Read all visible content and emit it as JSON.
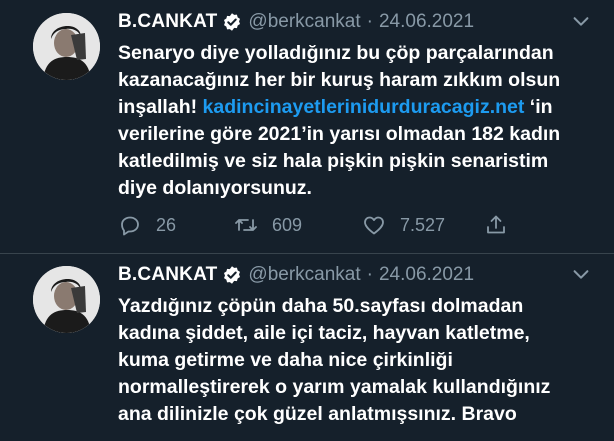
{
  "tweets": [
    {
      "display_name": "B.CANKAT",
      "handle": "@berkcankat",
      "separator": "·",
      "date": "24.06.2021",
      "text_lines": [
        "Senaryo diye yolladığınız bu çöp parçalarından",
        "kazanacağınız her bir kuruş haram zıkkım olsun"
      ],
      "line3_before": "inşallah! ",
      "link": "kadincinayetlerinidurduracagiz.net",
      "line3_after": " ‘in",
      "text_lines_after": [
        "verilerine göre 2021’in yarısı olmadan 182 kadın",
        "katledilmiş ve siz hala pişkin pişkin senaristim",
        "diye dolanıyorsunuz."
      ],
      "actions": {
        "replies": "26",
        "retweets": "609",
        "likes": "7.527"
      }
    },
    {
      "display_name": "B.CANKAT",
      "handle": "@berkcankat",
      "separator": "·",
      "date": "24.06.2021",
      "text_lines": [
        "Yazdığınız çöpün daha 50.sayfası dolmadan",
        "kadına şiddet, aile içi taciz, hayvan katletme,",
        "kuma getirme ve daha nice çirkinliği",
        "normalleştirerek o yarım yamalak kullandığınız",
        "ana dilinizle çok güzel anlatmışsınız. Bravo"
      ]
    }
  ],
  "icons": {
    "verified": "verified-badge-icon",
    "more": "chevron-down-icon",
    "reply": "reply-icon",
    "retweet": "retweet-icon",
    "like": "heart-icon",
    "share": "share-icon"
  },
  "colors": {
    "background": "#15202b",
    "text": "#ffffff",
    "secondary": "#8899a6",
    "link": "#1d9bf0",
    "divider": "#38444d"
  }
}
